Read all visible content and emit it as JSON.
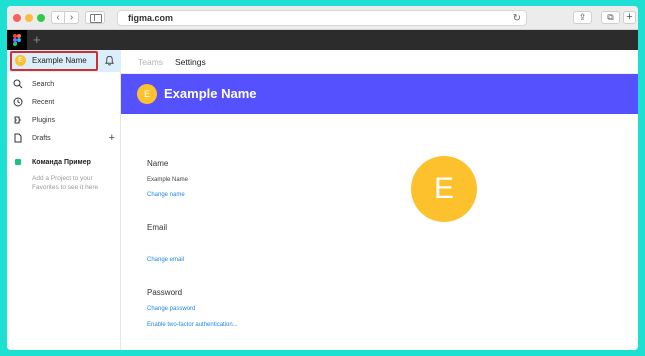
{
  "browser": {
    "url": "figma.com",
    "nav_back": "‹",
    "nav_forward": "›",
    "reload": "↻",
    "share": "⇪",
    "tabs": "⧉",
    "new_tab": "+"
  },
  "figma_bar": {
    "new_tab": "+"
  },
  "sidebar": {
    "user": {
      "initial": "E",
      "name": "Example Name"
    },
    "items": [
      {
        "label": "Search",
        "icon": "search-icon"
      },
      {
        "label": "Recent",
        "icon": "clock-icon"
      },
      {
        "label": "Plugins",
        "icon": "plugin-icon"
      },
      {
        "label": "Drafts",
        "icon": "file-icon"
      }
    ],
    "drafts_add": "+",
    "team": {
      "name": "Команда Пример",
      "color": "#1bc47d"
    },
    "team_hint": "Add a Project to your Favorites to see it here"
  },
  "main": {
    "tabs": [
      {
        "label": "Teams",
        "active": false
      },
      {
        "label": "Settings",
        "active": true
      }
    ],
    "banner": {
      "initial": "E",
      "title": "Example Name",
      "color": "#5551ff"
    },
    "avatar_initial": "E",
    "name_section": {
      "label": "Name",
      "value": "Example Name",
      "link": "Change name"
    },
    "email_section": {
      "label": "Email",
      "link": "Change email"
    },
    "password_section": {
      "label": "Password",
      "link": "Change password",
      "link2": "Enable two-factor authentication..."
    }
  },
  "colors": {
    "accent": "#5551ff",
    "avatar": "#fcc12d",
    "link": "#1e88e5",
    "background": "#1ee0d2"
  }
}
